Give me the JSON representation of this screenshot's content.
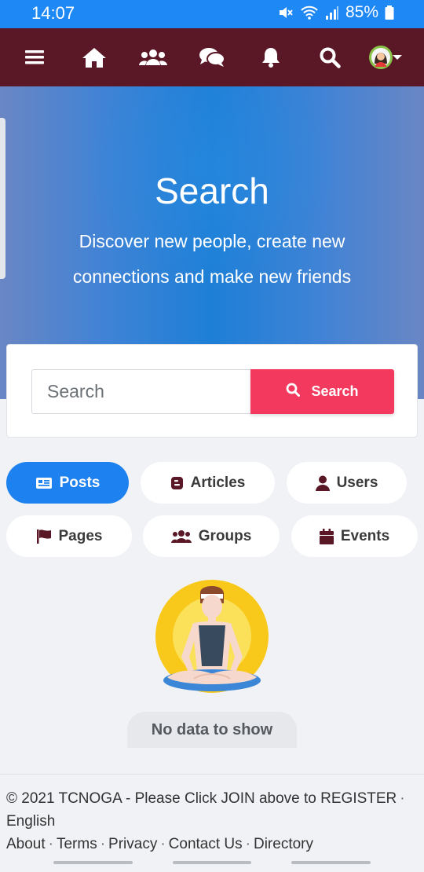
{
  "status_bar": {
    "time": "14:07",
    "battery": "85%",
    "icons": [
      "mute-icon",
      "wifi-icon",
      "signal-icon",
      "battery-icon"
    ]
  },
  "nav": {
    "icons": [
      "menu-icon",
      "home-icon",
      "friends-icon",
      "chat-icon",
      "bell-icon",
      "search-icon",
      "avatar",
      "chevron-down-icon"
    ],
    "bg_color": "#5a1726"
  },
  "hero": {
    "title": "Search",
    "subtitle_line1": "Discover new people, create new",
    "subtitle_line2": "connections and make new friends"
  },
  "search": {
    "placeholder": "Search",
    "button_label": "Search",
    "button_color": "#f3395e"
  },
  "tabs": [
    {
      "label": "Posts",
      "icon": "newspaper-icon",
      "active": true
    },
    {
      "label": "Articles",
      "icon": "blog-icon",
      "active": false
    },
    {
      "label": "Users",
      "icon": "user-icon",
      "active": false
    },
    {
      "label": "Pages",
      "icon": "flag-icon",
      "active": false
    },
    {
      "label": "Groups",
      "icon": "users-icon",
      "active": false
    },
    {
      "label": "Events",
      "icon": "calendar-icon",
      "active": false
    }
  ],
  "empty_state": {
    "illustration": "meditation-illustration",
    "message": "No data to show"
  },
  "footer": {
    "copyright": "© 2021 TCNOGA - Please Click JOIN above to REGISTER",
    "language": "English",
    "links": [
      "About",
      "Terms",
      "Privacy",
      "Contact Us",
      "Directory"
    ]
  },
  "accent_color": "#1d82ef"
}
